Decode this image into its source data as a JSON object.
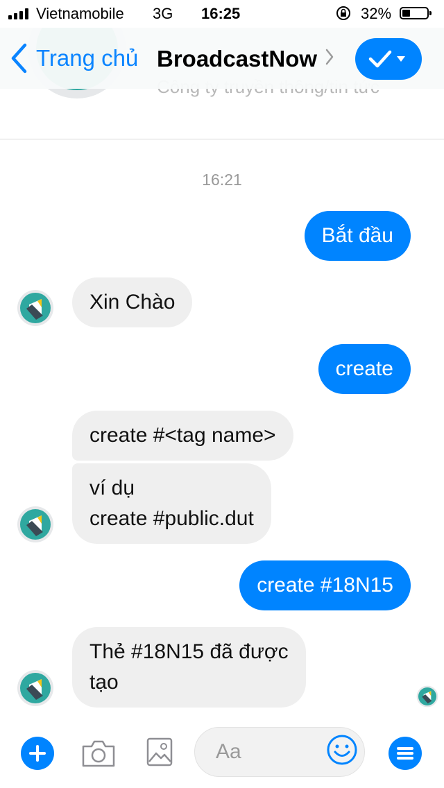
{
  "status_bar": {
    "carrier": "Vietnamobile",
    "network": "3G",
    "time": "16:25",
    "battery": "32%",
    "battery_level": 0.32
  },
  "nav": {
    "back_label": "Trang chủ",
    "title": "BroadcastNow"
  },
  "profile": {
    "subtitle": "Công ty truyền thông/tin tức"
  },
  "chat": {
    "timestamp": "16:21",
    "messages": [
      {
        "from": "me",
        "text": "Bắt đầu"
      },
      {
        "from": "bot",
        "text": "Xin Chào"
      },
      {
        "from": "me",
        "text": "create"
      },
      {
        "from": "bot",
        "text": "create #<tag name>"
      },
      {
        "from": "bot",
        "line1": "ví dụ",
        "line2": "create #public.dut"
      },
      {
        "from": "me",
        "text": "create #18N15"
      },
      {
        "from": "bot",
        "line1": "Thẻ #18N15 đã được",
        "line2": "tạo"
      }
    ]
  },
  "composer": {
    "placeholder": "Aa"
  },
  "colors": {
    "accent": "#0084ff",
    "incoming_bubble": "#efefef",
    "brand_teal": "#2fa8a0"
  }
}
